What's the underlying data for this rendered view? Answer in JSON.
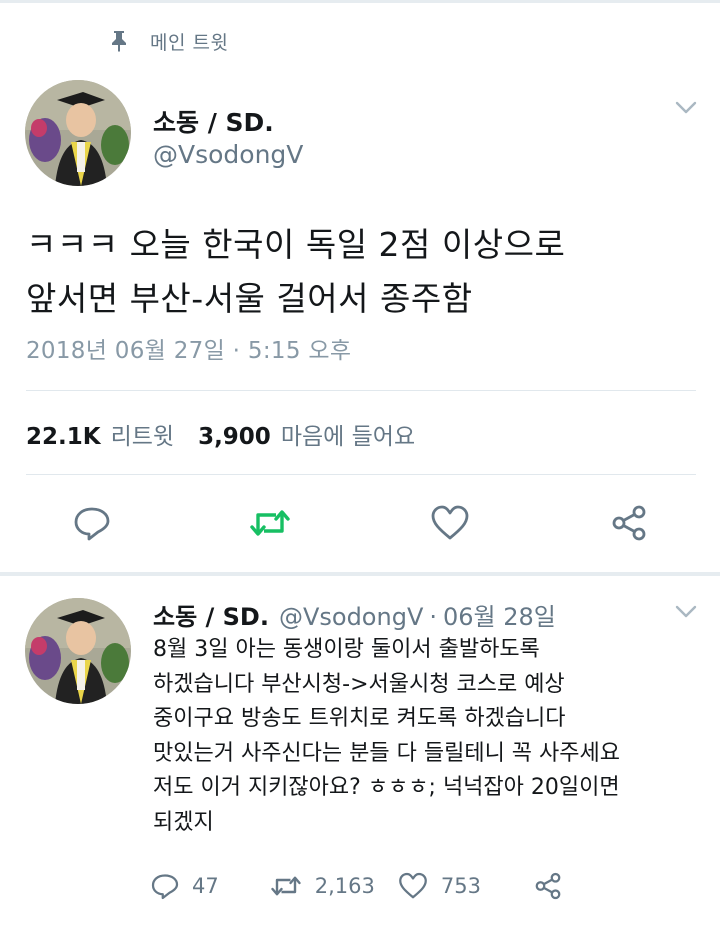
{
  "pinned": {
    "label": "메인 트윗"
  },
  "tweet": {
    "name": "소동 / SD.",
    "handle": "@VsodongV",
    "text_lines": [
      "ㅋㅋㅋ 오늘 한국이 독일 2점 이상으로",
      "앞서면 부산-서울 걸어서 종주함"
    ],
    "timestamp": "2018년 06월 27일 · 5:15 오후",
    "retweets": "22.1K",
    "retweets_label": "리트윗",
    "likes": "3,900",
    "likes_label": "마음에 들어요"
  },
  "reply": {
    "name": "소동 / SD.",
    "handle": "@VsodongV",
    "separator": "·",
    "date": "06월 28일",
    "text_lines": [
      "8월 3일 아는 동생이랑 둘이서 출발하도록",
      "하겠습니다 부산시청->서울시청 코스로 예상",
      "중이구요 방송도 트위치로 켜도록 하겠습니다",
      "맛있는거 사주신다는 분들 다 들릴테니 꼭 사주세요",
      "저도 이거 지키잖아요? ㅎㅎㅎ; 넉넉잡아 20일이면",
      "되겠지"
    ],
    "reply_count": "47",
    "retweet_count": "2,163",
    "like_count": "753"
  },
  "colors": {
    "retweet_active": "#17bf63",
    "icon_gray": "#657786",
    "muted_text": "#8899a6"
  },
  "icons": [
    "pin-icon",
    "chevron-down-icon",
    "reply-icon",
    "retweet-icon",
    "like-icon",
    "share-icon"
  ]
}
